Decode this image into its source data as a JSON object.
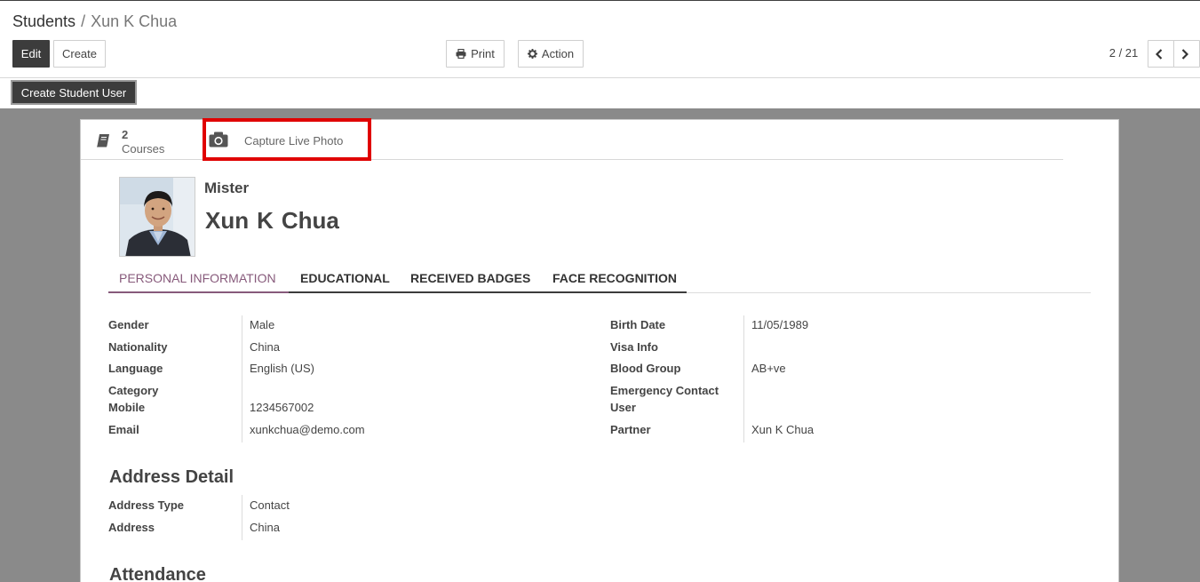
{
  "breadcrumb": {
    "parent": "Students",
    "separator": "/",
    "current": "Xun K Chua"
  },
  "toolbar": {
    "edit_label": "Edit",
    "create_label": "Create",
    "print_label": "Print",
    "action_label": "Action"
  },
  "pager": {
    "value": "2 / 21"
  },
  "header": {
    "create_student_user_label": "Create Student User"
  },
  "button_box": {
    "courses_count": "2",
    "courses_label": "Courses",
    "capture_label": "Capture Live Photo"
  },
  "student": {
    "prefix": "Mister",
    "first_name": "Xun",
    "middle_name": "K",
    "last_name": "Chua"
  },
  "tabs": [
    {
      "label": "PERSONAL INFORMATION"
    },
    {
      "label": "EDUCATIONAL"
    },
    {
      "label": "RECEIVED BADGES"
    },
    {
      "label": "FACE RECOGNITION"
    }
  ],
  "personal_left": {
    "gender_label": "Gender",
    "gender": "Male",
    "nationality_label": "Nationality",
    "nationality": "China",
    "language_label": "Language",
    "language": "English (US)",
    "category_label": "Category",
    "category": "",
    "mobile_label": "Mobile",
    "mobile": "1234567002",
    "email_label": "Email",
    "email": "xunkchua@demo.com"
  },
  "personal_right": {
    "birth_date_label": "Birth Date",
    "birth_date": "11/05/1989",
    "visa_label": "Visa Info",
    "visa": "",
    "blood_group_label": "Blood Group",
    "blood_group": "AB+ve",
    "emergency_label_1": "Emergency Contact",
    "emergency_label_2": "User",
    "emergency": "",
    "partner_label": "Partner",
    "partner": "Xun K Chua"
  },
  "address": {
    "section_title": "Address Detail",
    "type_label": "Address Type",
    "type": "Contact",
    "address_label": "Address",
    "address": "China"
  },
  "attendance": {
    "section_title": "Attendance"
  },
  "icons": {
    "print": "print-icon",
    "action": "gear-icon",
    "prev": "chevron-left-icon",
    "next": "chevron-right-icon",
    "courses": "book-icon",
    "capture": "camera-icon"
  },
  "colors": {
    "accent": "#875a7b",
    "highlight_border": "#e00000",
    "dark_button": "#3c3c3c"
  }
}
